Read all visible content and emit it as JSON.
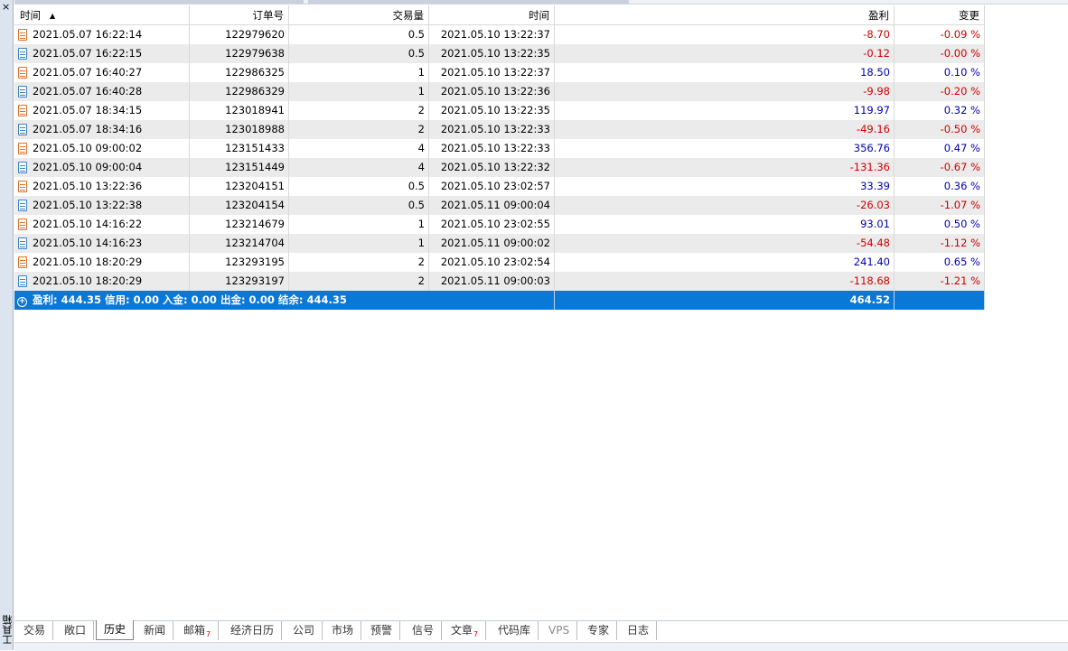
{
  "sidebar": {
    "close_glyph": "×",
    "label": "工具箱"
  },
  "table": {
    "headers": {
      "open_time": "时间",
      "order": "订单号",
      "volume": "交易量",
      "close_time": "时间",
      "profit": "盈利",
      "change": "变更"
    },
    "sort_icon": "sort-ascending-icon",
    "rows": [
      {
        "type": "sell",
        "open_time": "2021.05.07 16:22:14",
        "order": "122979620",
        "volume": "0.5",
        "close_time": "2021.05.10 13:22:37",
        "profit": "-8.70",
        "change": "-0.09 %"
      },
      {
        "type": "buy",
        "open_time": "2021.05.07 16:22:15",
        "order": "122979638",
        "volume": "0.5",
        "close_time": "2021.05.10 13:22:35",
        "profit": "-0.12",
        "change": "-0.00 %"
      },
      {
        "type": "sell",
        "open_time": "2021.05.07 16:40:27",
        "order": "122986325",
        "volume": "1",
        "close_time": "2021.05.10 13:22:37",
        "profit": "18.50",
        "change": "0.10 %"
      },
      {
        "type": "buy",
        "open_time": "2021.05.07 16:40:28",
        "order": "122986329",
        "volume": "1",
        "close_time": "2021.05.10 13:22:36",
        "profit": "-9.98",
        "change": "-0.20 %"
      },
      {
        "type": "sell",
        "open_time": "2021.05.07 18:34:15",
        "order": "123018941",
        "volume": "2",
        "close_time": "2021.05.10 13:22:35",
        "profit": "119.97",
        "change": "0.32 %"
      },
      {
        "type": "buy",
        "open_time": "2021.05.07 18:34:16",
        "order": "123018988",
        "volume": "2",
        "close_time": "2021.05.10 13:22:33",
        "profit": "-49.16",
        "change": "-0.50 %"
      },
      {
        "type": "sell",
        "open_time": "2021.05.10 09:00:02",
        "order": "123151433",
        "volume": "4",
        "close_time": "2021.05.10 13:22:33",
        "profit": "356.76",
        "change": "0.47 %"
      },
      {
        "type": "buy",
        "open_time": "2021.05.10 09:00:04",
        "order": "123151449",
        "volume": "4",
        "close_time": "2021.05.10 13:22:32",
        "profit": "-131.36",
        "change": "-0.67 %"
      },
      {
        "type": "sell",
        "open_time": "2021.05.10 13:22:36",
        "order": "123204151",
        "volume": "0.5",
        "close_time": "2021.05.10 23:02:57",
        "profit": "33.39",
        "change": "0.36 %"
      },
      {
        "type": "buy",
        "open_time": "2021.05.10 13:22:38",
        "order": "123204154",
        "volume": "0.5",
        "close_time": "2021.05.11 09:00:04",
        "profit": "-26.03",
        "change": "-1.07 %"
      },
      {
        "type": "sell",
        "open_time": "2021.05.10 14:16:22",
        "order": "123214679",
        "volume": "1",
        "close_time": "2021.05.10 23:02:55",
        "profit": "93.01",
        "change": "0.50 %"
      },
      {
        "type": "buy",
        "open_time": "2021.05.10 14:16:23",
        "order": "123214704",
        "volume": "1",
        "close_time": "2021.05.11 09:00:02",
        "profit": "-54.48",
        "change": "-1.12 %"
      },
      {
        "type": "sell",
        "open_time": "2021.05.10 18:20:29",
        "order": "123293195",
        "volume": "2",
        "close_time": "2021.05.10 23:02:54",
        "profit": "241.40",
        "change": "0.65 %"
      },
      {
        "type": "buy",
        "open_time": "2021.05.10 18:20:29",
        "order": "123293197",
        "volume": "2",
        "close_time": "2021.05.11 09:00:03",
        "profit": "-118.68",
        "change": "-1.21 %"
      }
    ],
    "summary": {
      "text": "盈利: 444.35  信用: 0.00  入金: 0.00  出金: 0.00  结余: 444.35",
      "total_profit": "464.52"
    }
  },
  "tabs": [
    {
      "label": "交易",
      "badge": ""
    },
    {
      "label": "敞口",
      "badge": ""
    },
    {
      "label": "历史",
      "badge": "",
      "active": true
    },
    {
      "label": "新闻",
      "badge": ""
    },
    {
      "label": "邮箱",
      "badge": "7"
    },
    {
      "label": "经济日历",
      "badge": ""
    },
    {
      "label": "公司",
      "badge": ""
    },
    {
      "label": "市场",
      "badge": ""
    },
    {
      "label": "预警",
      "badge": ""
    },
    {
      "label": "信号",
      "badge": ""
    },
    {
      "label": "文章",
      "badge": "7"
    },
    {
      "label": "代码库",
      "badge": ""
    },
    {
      "label": "VPS",
      "badge": "",
      "dim": true
    },
    {
      "label": "专家",
      "badge": ""
    },
    {
      "label": "日志",
      "badge": ""
    }
  ],
  "colors": {
    "negative": "#d00000",
    "positive": "#0000b4",
    "summary_bg": "#0a78d7",
    "alt_row": "#ebebeb"
  }
}
